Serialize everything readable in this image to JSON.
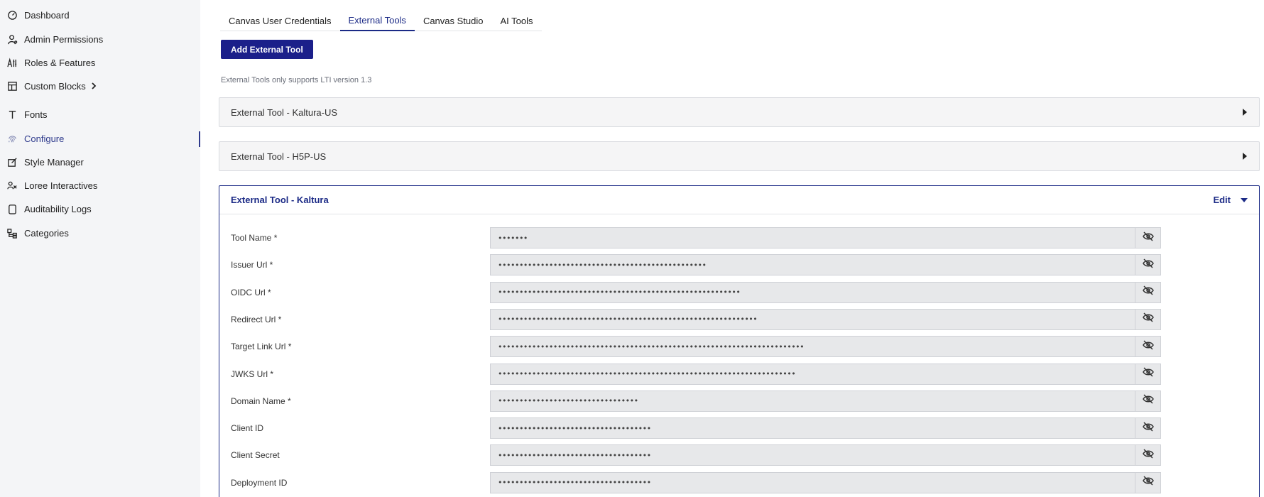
{
  "sidebar": {
    "items": [
      {
        "label": "Dashboard",
        "icon": "gauge-icon"
      },
      {
        "label": "Admin Permissions",
        "icon": "user-key-icon"
      },
      {
        "label": "Roles & Features",
        "icon": "roles-icon"
      },
      {
        "label": "Custom Blocks",
        "icon": "blocks-icon"
      },
      {
        "label": "Fonts",
        "icon": "font-icon"
      },
      {
        "label": "Configure",
        "icon": "fingerprint-icon"
      },
      {
        "label": "Style Manager",
        "icon": "edit-icon"
      },
      {
        "label": "Loree Interactives",
        "icon": "interactives-icon"
      },
      {
        "label": "Auditability Logs",
        "icon": "clipboard-icon"
      },
      {
        "label": "Categories",
        "icon": "categories-icon"
      }
    ],
    "active": "Configure"
  },
  "tabs": [
    {
      "label": "Canvas User Credentials"
    },
    {
      "label": "External Tools"
    },
    {
      "label": "Canvas Studio"
    },
    {
      "label": "AI Tools"
    }
  ],
  "active_tab": "External Tools",
  "add_button_label": "Add External Tool",
  "note": "External Tools only supports LTI version 1.3",
  "accordions": [
    {
      "title": "External Tool - Kaltura-US",
      "expanded": false
    },
    {
      "title": "External Tool - H5P-US",
      "expanded": false
    },
    {
      "title": "External Tool - Kaltura",
      "expanded": true,
      "edit_label": "Edit"
    }
  ],
  "fields": [
    {
      "label": "Tool Name *",
      "value": "•••••••"
    },
    {
      "label": "Issuer Url *",
      "value": "•••••••••••••••••••••••••••••••••••••••••••••••••"
    },
    {
      "label": "OIDC Url *",
      "value": "•••••••••••••••••••••••••••••••••••••••••••••••••••••••••"
    },
    {
      "label": "Redirect Url *",
      "value": "•••••••••••••••••••••••••••••••••••••••••••••••••••••••••••••"
    },
    {
      "label": "Target Link Url *",
      "value": "••••••••••••••••••••••••••••••••••••••••••••••••••••••••••••••••••••••••"
    },
    {
      "label": "JWKS Url *",
      "value": "••••••••••••••••••••••••••••••••••••••••••••••••••••••••••••••••••••••"
    },
    {
      "label": "Domain Name *",
      "value": "•••••••••••••••••••••••••••••••••"
    },
    {
      "label": "Client ID",
      "value": "••••••••••••••••••••••••••••••••••••"
    },
    {
      "label": "Client Secret",
      "value": "••••••••••••••••••••••••••••••••••••"
    },
    {
      "label": "Deployment ID",
      "value": "••••••••••••••••••••••••••••••••••••"
    }
  ],
  "colors": {
    "accent": "#1b2a86",
    "button": "#1b1f8a",
    "sidebar_bg": "#f4f5f7"
  }
}
